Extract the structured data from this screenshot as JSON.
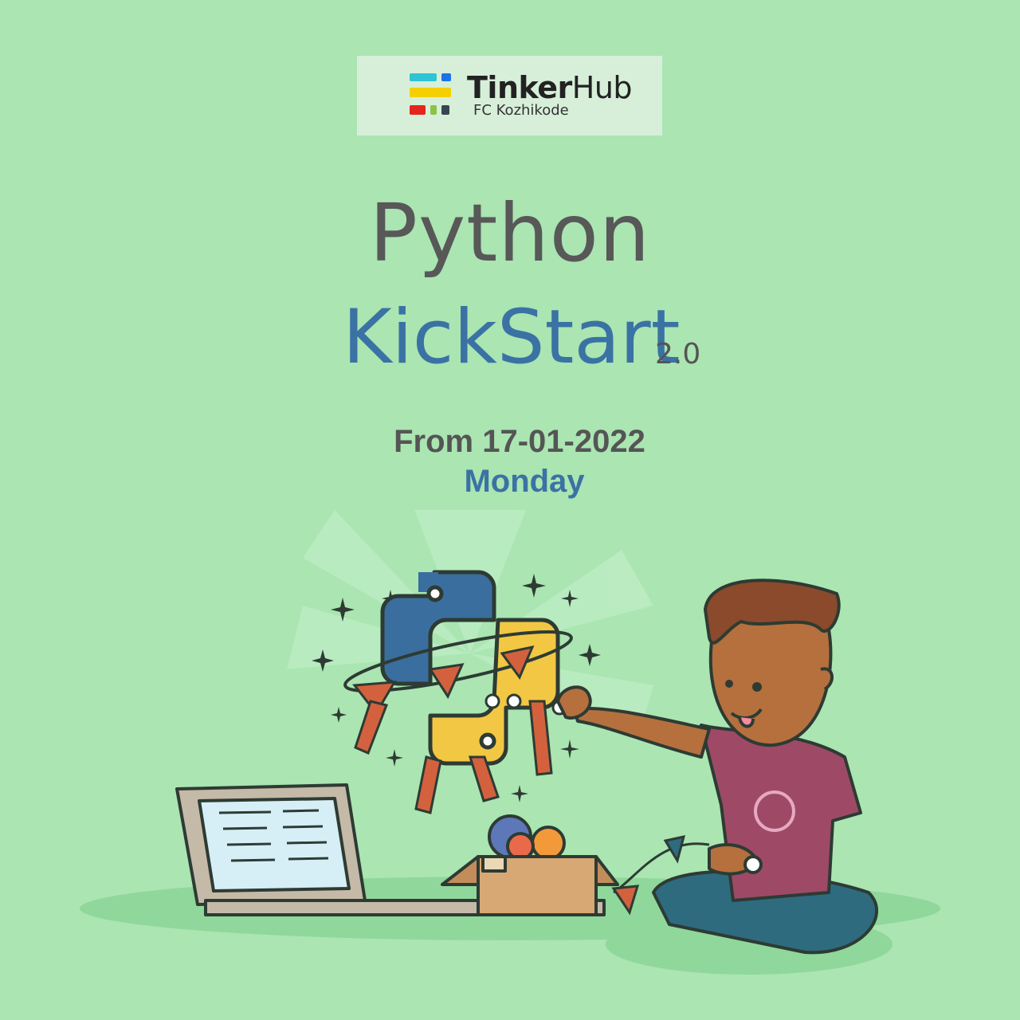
{
  "logo": {
    "word1": "Tinker",
    "word2": "Hub",
    "subtitle": "FC Kozhikode"
  },
  "title": {
    "line1": "Python",
    "line2": "KickStart",
    "version": "2.0"
  },
  "event": {
    "date": "From 17-01-2022",
    "day": "Monday"
  },
  "colors": {
    "background": "#aae5b2",
    "accent_blue": "#3b72a4",
    "text_gray": "#555555",
    "python_blue": "#3a6e9e",
    "python_yellow": "#f2c744"
  }
}
